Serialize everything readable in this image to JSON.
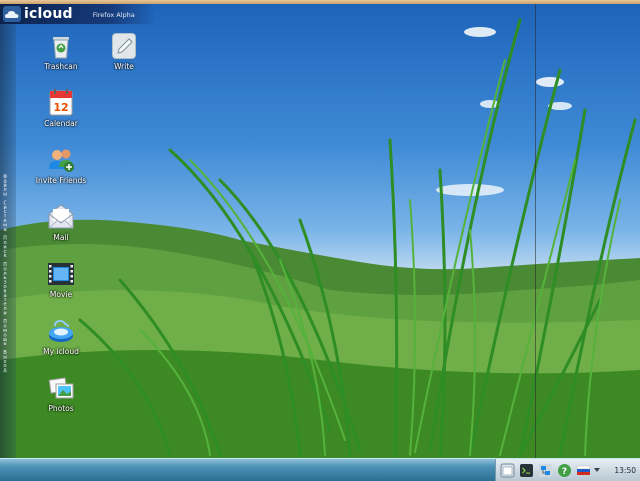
{
  "topbar": {
    "logo_icon": "cloud-logo-icon",
    "title": "icloud",
    "subtitle": "Firefox Alpha"
  },
  "desktop_icons": [
    {
      "label": "Trashcan",
      "icon": "recycle-bin-icon"
    },
    {
      "label": "Write",
      "icon": "pencil-icon"
    },
    {
      "label": "Calendar",
      "icon": "calendar-icon",
      "day": "12"
    },
    {
      "label": "Invite Friends",
      "icon": "add-contact-icon"
    },
    {
      "label": "Mail",
      "icon": "envelope-icon"
    },
    {
      "label": "Movie",
      "icon": "film-strip-icon"
    },
    {
      "label": "My icloud",
      "icon": "cloud-drive-icon"
    },
    {
      "label": "Photos",
      "icon": "photos-icon"
    }
  ],
  "left_dock": {
    "text": "Файлы Система Поиск Пользователи Помощь Выход"
  },
  "tray": {
    "icons": [
      "window-icon",
      "terminal-icon",
      "network-icon",
      "help-icon",
      "flag-icon",
      "arrow-icon"
    ],
    "clock": "13:50"
  },
  "colors": {
    "sky": "#3f8ad6",
    "grass": "#3f8a23",
    "taskbar": "#2c6f95"
  }
}
